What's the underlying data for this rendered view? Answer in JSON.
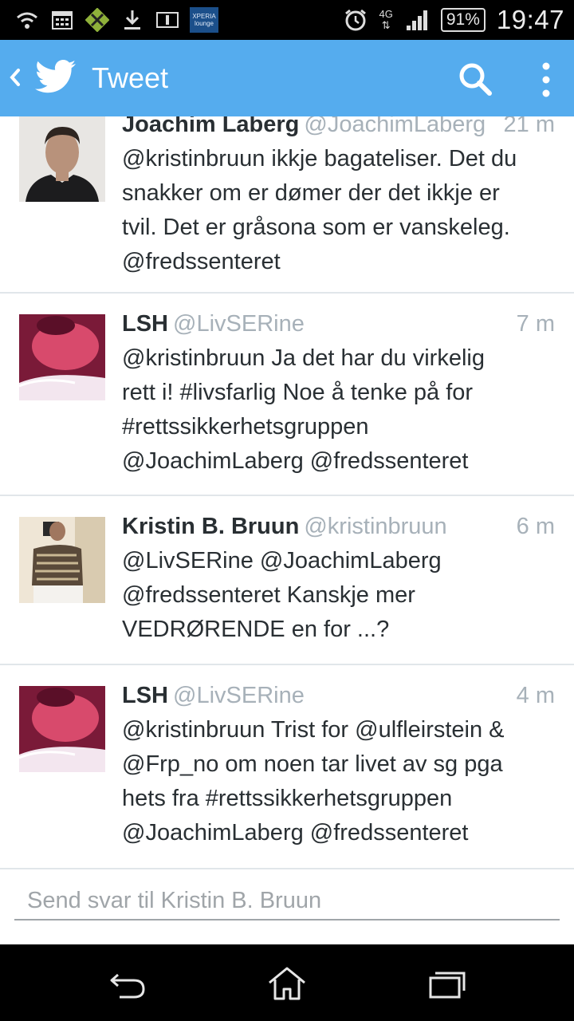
{
  "status_bar": {
    "network_label": "4G",
    "battery_percent": "91%",
    "time": "19:47",
    "xperia_label": "XPERIA lounge",
    "icons": [
      "wifi-question-icon",
      "calendar-icon",
      "app-icon",
      "download-icon",
      "info-icon",
      "xperia-lounge-icon",
      "alarm-icon",
      "signal-icon",
      "battery-icon"
    ]
  },
  "action_bar": {
    "title": "Tweet",
    "icons": [
      "back-chevron-icon",
      "twitter-bird-icon",
      "search-icon",
      "more-vert-icon"
    ],
    "brand_color": "#55acee"
  },
  "tweets": [
    {
      "name": "Joachim Laberg",
      "handle": "@JoachimLaberg",
      "time": "21 m",
      "lines": [
        "@kristinbruun ikkje bagateliser. Det du",
        "snakker om er dømer der det ikkje er",
        "tvil. Det er gråsona som er vanskeleg.",
        "@fredssenteret"
      ]
    },
    {
      "name": "LSH",
      "handle": "@LivSERine",
      "time": "7 m",
      "lines": [
        "@kristinbruun Ja det har du virkelig",
        "rett i! #livsfarlig Noe å tenke på for",
        "#rettssikkerhetsgruppen",
        "@JoachimLaberg @fredssenteret"
      ]
    },
    {
      "name": "Kristin B. Bruun",
      "handle": "@kristinbruun",
      "time": "6 m",
      "lines": [
        "@LivSERine @JoachimLaberg",
        "@fredssenteret Kanskje mer",
        "VEDRØRENDE en for ...?"
      ]
    },
    {
      "name": "LSH",
      "handle": "@LivSERine",
      "time": "4 m",
      "lines": [
        "@kristinbruun Trist for @ulfleirstein &",
        "@Frp_no om noen tar livet av sg pga",
        "hets fra #rettssikkerhetsgruppen",
        "@JoachimLaberg @fredssenteret"
      ]
    }
  ],
  "reply": {
    "placeholder": "Send svar til Kristin B. Bruun",
    "value": ""
  },
  "nav_bar": {
    "icons": [
      "back-icon",
      "home-icon",
      "recent-apps-icon"
    ]
  }
}
